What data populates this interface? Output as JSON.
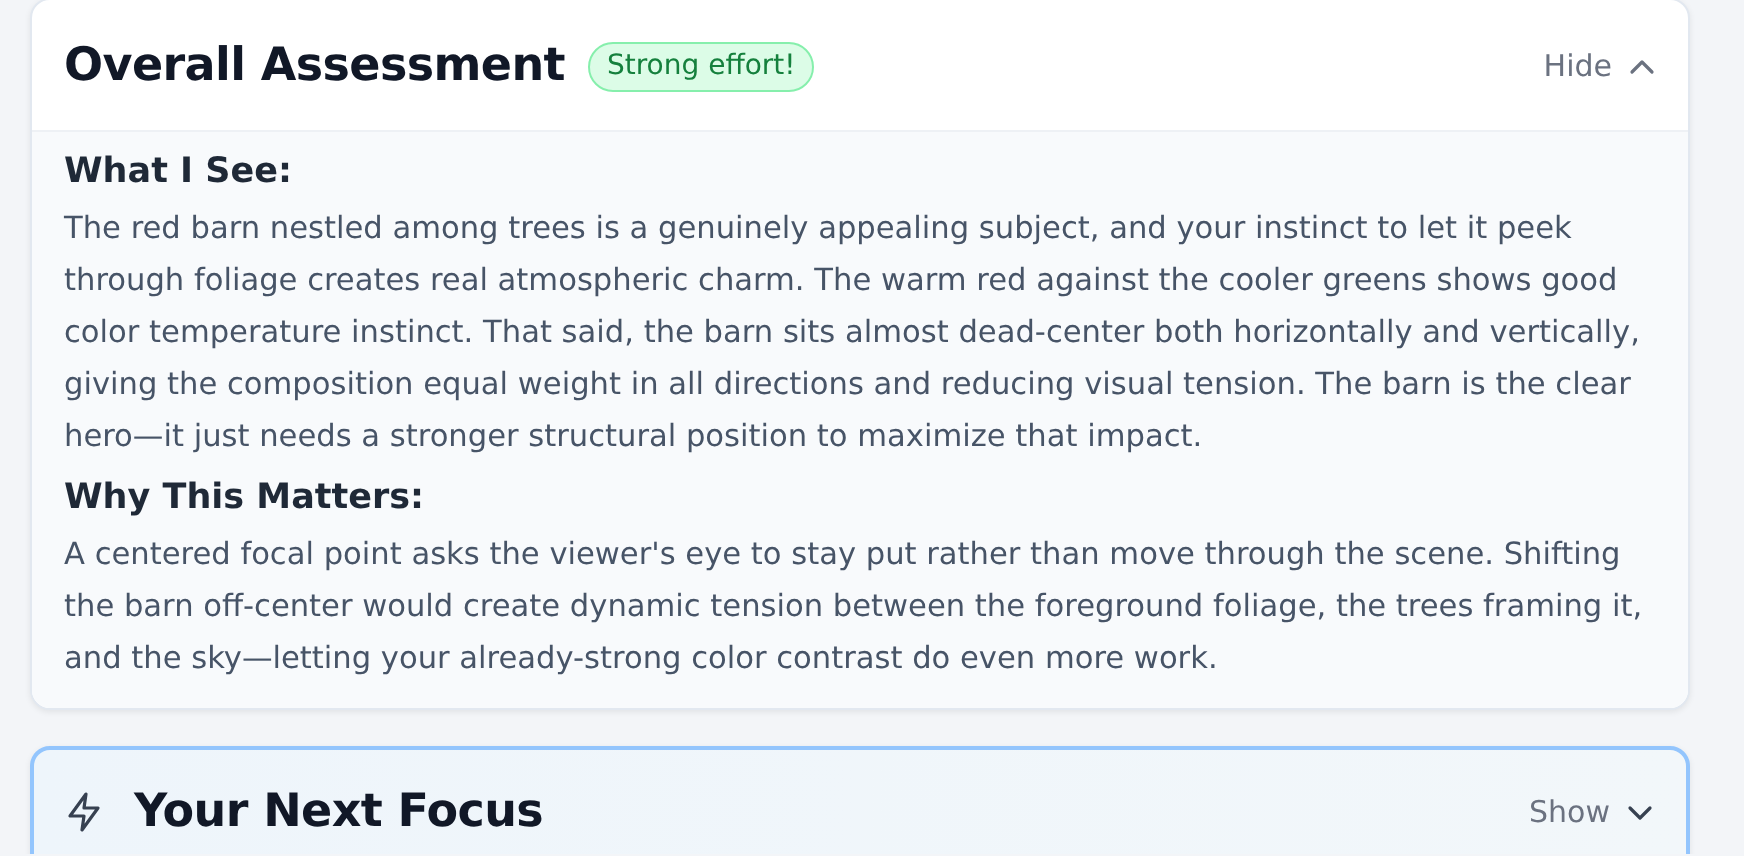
{
  "panels": [
    {
      "title": "Overall Assessment",
      "badge": "Strong effort!",
      "toggle": "Hide",
      "expanded": true,
      "highlighted": false,
      "kind": "assessment",
      "sections": [
        {
          "heading": "What I See:",
          "text": "The red barn nestled among trees is a genuinely appealing subject, and your instinct to let it peek through foliage creates real atmospheric charm. The warm red against the cooler greens shows good color temperature instinct. That said, the barn sits almost dead-center both horizontally and vertically, giving the composition equal weight in all directions and reducing visual tension. The barn is the clear hero—it just needs a stronger structural position to maximize that impact."
        },
        {
          "heading": "Why This Matters:",
          "text": "A centered focal point asks the viewer's eye to stay put rather than move through the scene. Shifting the barn off-center would create dynamic tension between the foreground foliage, the trees framing it, and the sky—letting your already-strong color contrast do even more work."
        }
      ]
    },
    {
      "title": "Your Next Focus",
      "toggle": "Show",
      "expanded": false,
      "highlighted": true,
      "kind": "focus"
    }
  ]
}
